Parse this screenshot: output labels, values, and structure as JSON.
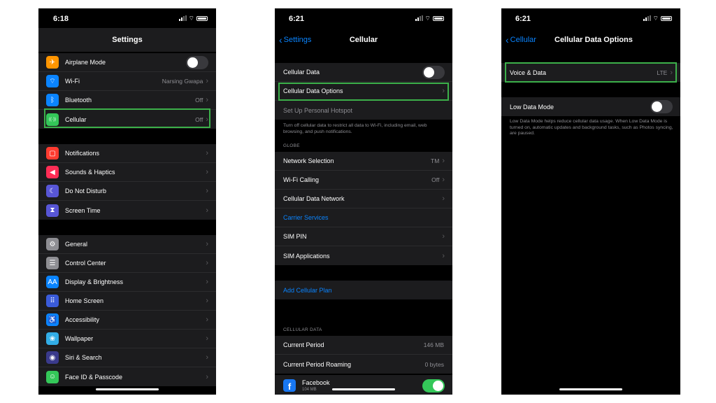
{
  "screens": {
    "settings": {
      "time": "6:18",
      "title": "Settings",
      "group1": [
        {
          "label": "Airplane Mode",
          "icon": "airplane-icon",
          "color": "#ff9500",
          "glyph": "✈",
          "toggle": "off"
        },
        {
          "label": "Wi-Fi",
          "value": "Narsing Gwapa",
          "icon": "wifi-icon",
          "color": "#0a84ff",
          "glyph": "⌔"
        },
        {
          "label": "Bluetooth",
          "value": "Off",
          "icon": "bluetooth-icon",
          "color": "#0a84ff",
          "glyph": "ᛒ"
        },
        {
          "label": "Cellular",
          "value": "Off",
          "icon": "cellular-antenna-icon",
          "color": "#34c759",
          "glyph": "((·))"
        }
      ],
      "group2": [
        {
          "label": "Notifications",
          "icon": "notifications-icon",
          "color": "#ff3b30",
          "glyph": "▢"
        },
        {
          "label": "Sounds & Haptics",
          "icon": "speaker-icon",
          "color": "#ff2d55",
          "glyph": "◀"
        },
        {
          "label": "Do Not Disturb",
          "icon": "moon-icon",
          "color": "#5856d6",
          "glyph": "☾"
        },
        {
          "label": "Screen Time",
          "icon": "hourglass-icon",
          "color": "#5856d6",
          "glyph": "⧗"
        }
      ],
      "group3": [
        {
          "label": "General",
          "icon": "gear-icon",
          "color": "#8e8e93",
          "glyph": "⚙"
        },
        {
          "label": "Control Center",
          "icon": "switches-icon",
          "color": "#8e8e93",
          "glyph": "☰"
        },
        {
          "label": "Display & Brightness",
          "icon": "text-size-icon",
          "color": "#0a84ff",
          "glyph": "AA"
        },
        {
          "label": "Home Screen",
          "icon": "home-grid-icon",
          "color": "#3a5bd9",
          "glyph": "⠿"
        },
        {
          "label": "Accessibility",
          "icon": "accessibility-icon",
          "color": "#0a84ff",
          "glyph": "♿"
        },
        {
          "label": "Wallpaper",
          "icon": "flower-icon",
          "color": "#32ade6",
          "glyph": "❀"
        },
        {
          "label": "Siri & Search",
          "icon": "siri-icon",
          "color": "#3a3a8c",
          "glyph": "◉"
        },
        {
          "label": "Face ID & Passcode",
          "icon": "face-id-icon",
          "color": "#34c759",
          "glyph": "☺"
        }
      ]
    },
    "cellular": {
      "time": "6:21",
      "back": "Settings",
      "title": "Cellular",
      "group1": [
        {
          "label": "Cellular Data",
          "toggle": "off"
        },
        {
          "label": "Cellular Data Options",
          "chevron": true
        },
        {
          "label": "Set Up Personal Hotspot",
          "dim": true
        }
      ],
      "note": "Turn off cellular data to restrict all data to Wi-Fi, including email, web browsing, and push notifications.",
      "caption": "GLOBE",
      "group2": [
        {
          "label": "Network Selection",
          "value": "TM",
          "chevron": true
        },
        {
          "label": "Wi-Fi Calling",
          "value": "Off",
          "chevron": true
        },
        {
          "label": "Cellular Data Network",
          "chevron": true
        },
        {
          "label": "Carrier Services",
          "blue": true
        },
        {
          "label": "SIM PIN",
          "chevron": true
        },
        {
          "label": "SIM Applications",
          "chevron": true
        }
      ],
      "add_plan": "Add Cellular Plan",
      "data_caption": "CELLULAR DATA",
      "group3": [
        {
          "label": "Current Period",
          "value": "146 MB"
        },
        {
          "label": "Current Period Roaming",
          "value": "0 bytes"
        }
      ],
      "app": {
        "name": "Facebook",
        "size": "104 MB",
        "toggle": "on",
        "glyph": "f"
      }
    },
    "options": {
      "time": "6:21",
      "back": "Cellular",
      "title": "Cellular Data Options",
      "voice": {
        "label": "Voice & Data",
        "value": "LTE"
      },
      "low_data": {
        "label": "Low Data Mode",
        "toggle": "off"
      },
      "note": "Low Data Mode helps reduce cellular data usage. When Low Data Mode is turned on, automatic updates and background tasks, such as Photos syncing, are paused."
    }
  },
  "colors": {
    "highlight": "#3cb04a",
    "link": "#0a84ff",
    "toggle_on": "#34c759"
  }
}
